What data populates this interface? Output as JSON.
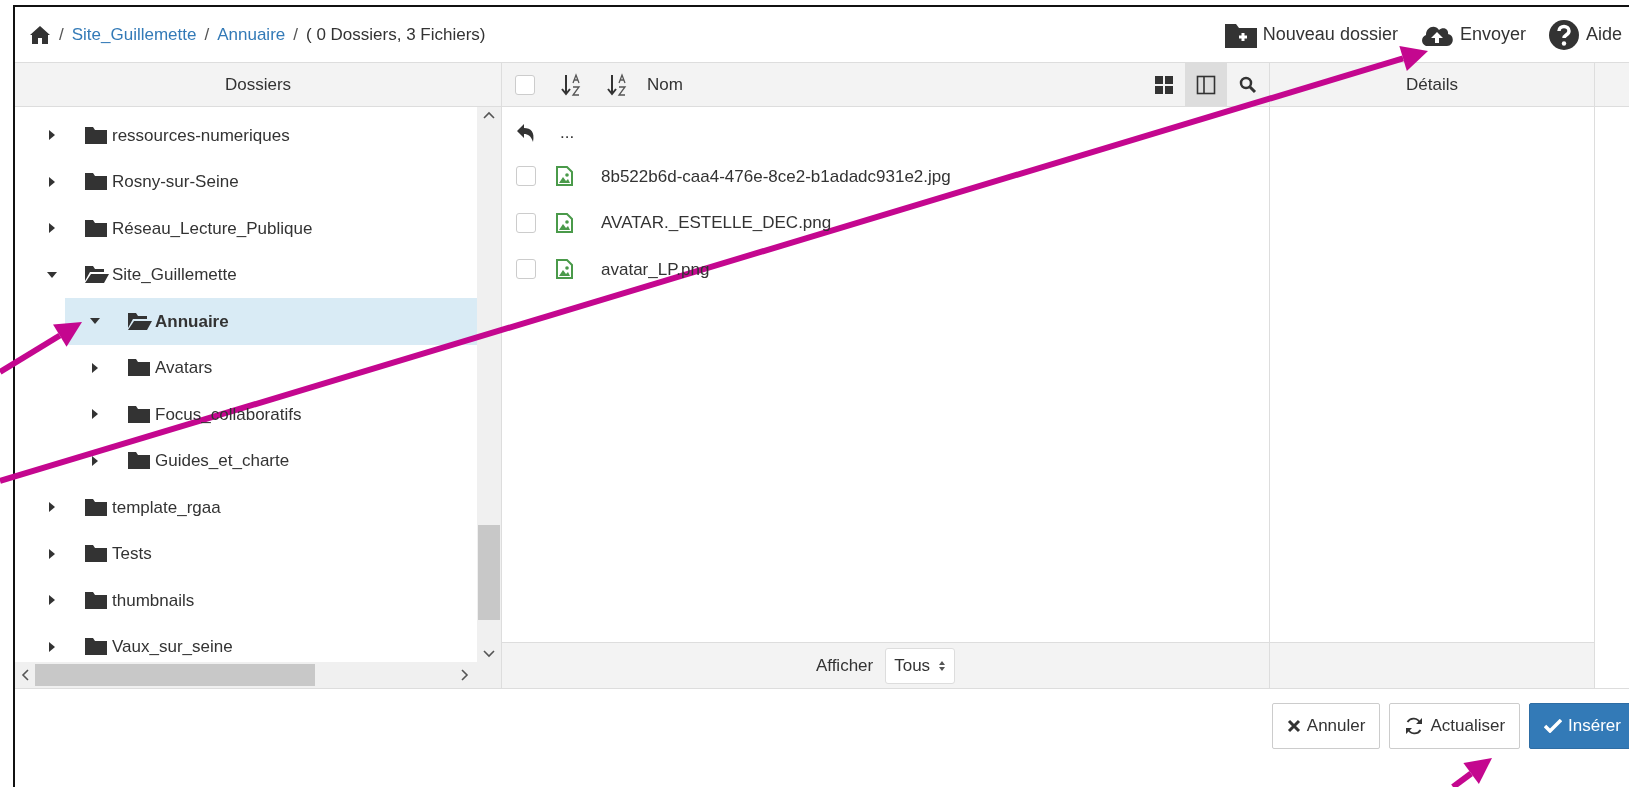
{
  "breadcrumb": [
    {
      "separator": "/",
      "label": "Site_Guillemette",
      "kind": "link"
    },
    {
      "separator": "/",
      "label": "Annuaire",
      "kind": "link"
    },
    {
      "separator": "/",
      "label": "( 0 Dossiers, 3 Fichiers)",
      "kind": "text"
    }
  ],
  "toolbar": [
    {
      "label": "Nouveau dossier",
      "kind": "new-folder"
    },
    {
      "label": "Envoyer",
      "kind": "upload"
    },
    {
      "label": "Aide",
      "kind": "help"
    }
  ],
  "folders": {
    "title": "Dossiers",
    "tree": [
      {
        "label": "ressources-numeriques",
        "expanded": false,
        "selected": false
      },
      {
        "label": "Rosny-sur-Seine",
        "expanded": false,
        "selected": false
      },
      {
        "label": "Réseau_Lecture_Publique",
        "expanded": false,
        "selected": false
      },
      {
        "label": "Site_Guillemette",
        "expanded": true,
        "selected": false,
        "children": [
          {
            "label": "Annuaire",
            "expanded": true,
            "selected": true
          },
          {
            "label": "Avatars",
            "expanded": false,
            "selected": false
          },
          {
            "label": "Focus_collaboratifs",
            "expanded": false,
            "selected": false
          },
          {
            "label": "Guides_et_charte",
            "expanded": false,
            "selected": false
          }
        ]
      },
      {
        "label": "template_rgaa",
        "expanded": false,
        "selected": false
      },
      {
        "label": "Tests",
        "expanded": false,
        "selected": false
      },
      {
        "label": "thumbnails",
        "expanded": false,
        "selected": false
      },
      {
        "label": "Vaux_sur_seine",
        "expanded": false,
        "selected": false
      }
    ]
  },
  "files": {
    "select_all_checked": false,
    "column": "Nom",
    "views": [
      {
        "kind": "grid",
        "selected": false
      },
      {
        "kind": "list",
        "selected": true
      }
    ],
    "parent": "...",
    "items": [
      {
        "name": "8b522b6d-caa4-476e-8ce2-b1adadc931e2.jpg",
        "checked": false
      },
      {
        "name": "AVATAR._ESTELLE_DEC.png",
        "checked": false
      },
      {
        "name": "avatar_LP.png",
        "checked": false
      }
    ],
    "footer": {
      "label": "Afficher",
      "value": "Tous"
    }
  },
  "details": {
    "title": "Détails"
  },
  "buttons": [
    {
      "label": "Annuler",
      "kind": "cancel",
      "primary": false
    },
    {
      "label": "Actualiser",
      "kind": "refresh",
      "primary": false
    },
    {
      "label": "Insérer",
      "kind": "insert",
      "primary": true
    }
  ],
  "annotation_arrows": [
    {
      "kind": "arrow"
    },
    {
      "kind": "arrow"
    },
    {
      "kind": "arrow"
    }
  ]
}
